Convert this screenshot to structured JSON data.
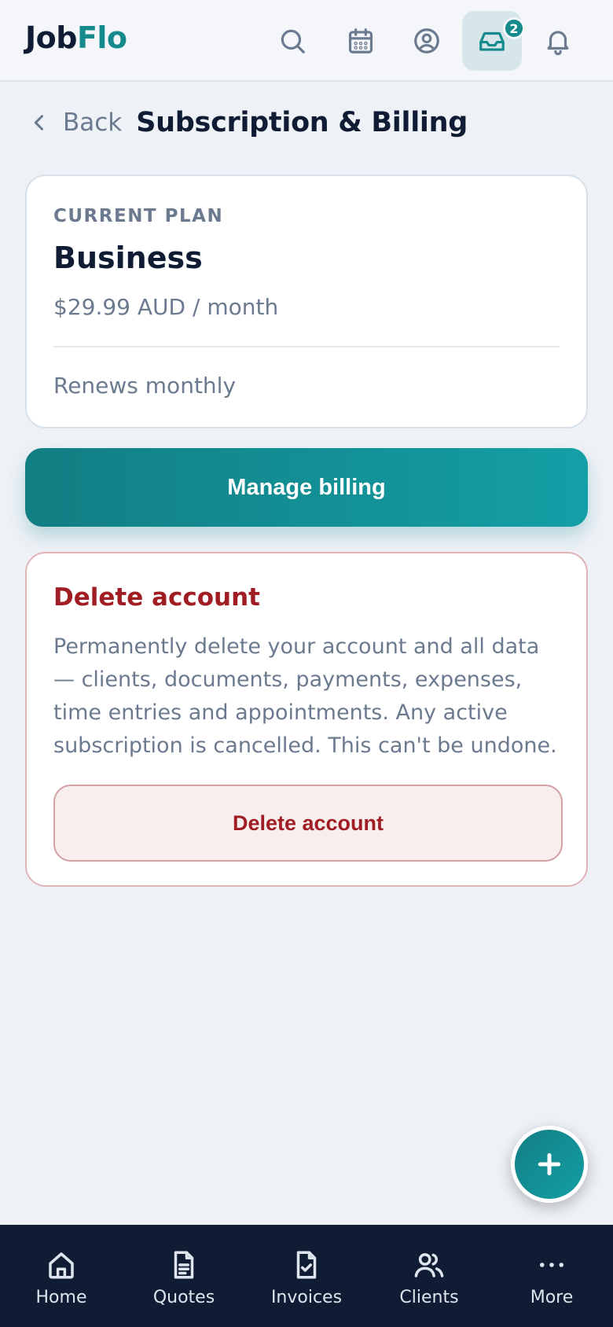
{
  "app": {
    "logo_part1": "Job",
    "logo_part2": "Flo",
    "accent_color": "#148a8c",
    "inbox_badge": "2",
    "icons": [
      "search-icon",
      "calendar-icon",
      "user-circle-icon",
      "inbox-icon",
      "bell-icon"
    ]
  },
  "header": {
    "back_label": "Back",
    "title": "Subscription & Billing"
  },
  "plan": {
    "label": "CURRENT PLAN",
    "name": "Business",
    "price": "$29.99 AUD / month",
    "renewal": "Renews monthly"
  },
  "actions": {
    "manage_billing": "Manage billing"
  },
  "danger": {
    "title": "Delete account",
    "description": "Permanently delete your account and all data — clients, documents, payments, expenses, time entries and appointments. Any active subscription is cancelled. This can't be undone.",
    "button": "Delete account",
    "color": "#a11d24"
  },
  "nav": {
    "items": [
      {
        "label": "Home",
        "icon": "home-icon"
      },
      {
        "label": "Quotes",
        "icon": "document-icon"
      },
      {
        "label": "Invoices",
        "icon": "invoice-check-icon"
      },
      {
        "label": "Clients",
        "icon": "users-icon"
      },
      {
        "label": "More",
        "icon": "more-dots-icon"
      }
    ]
  }
}
